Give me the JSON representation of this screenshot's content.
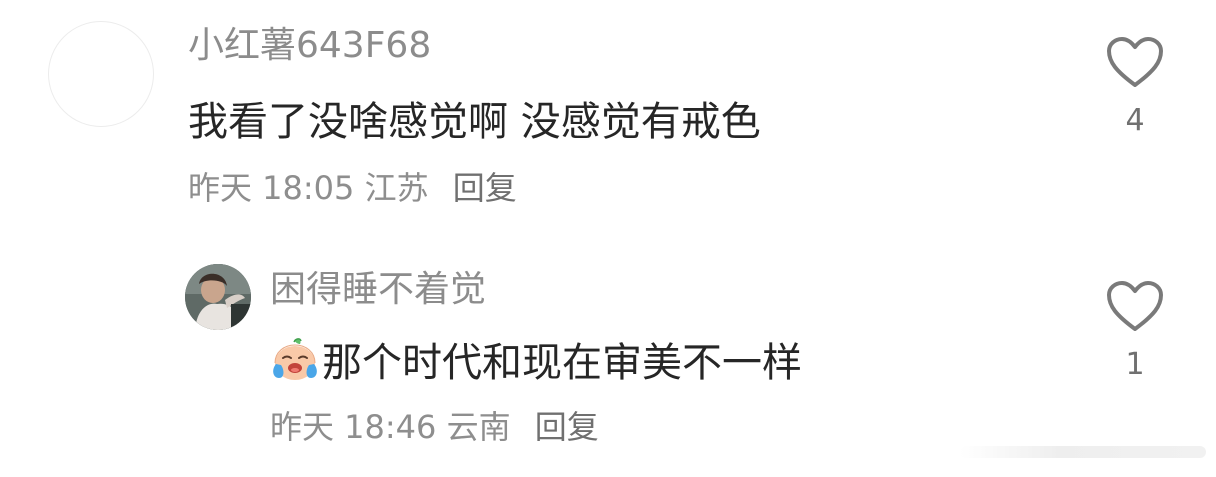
{
  "comments": [
    {
      "username": "小红薯643F68",
      "text": "我看了没啥感觉啊 没感觉有戒色",
      "time": "昨天 18:05",
      "location": "江苏",
      "reply_label": "回复",
      "likes": "4",
      "avatar": "empty"
    },
    {
      "username": "困得睡不着觉",
      "emoji": "crying-face-emoji",
      "text": "那个时代和现在审美不一样",
      "time": "昨天 18:46",
      "location": "云南",
      "reply_label": "回复",
      "likes": "1",
      "avatar": "photo"
    }
  ],
  "colors": {
    "username": "#8c8c8c",
    "text": "#262626",
    "meta": "#8e8e8e",
    "icon": "#7a7a7a"
  }
}
